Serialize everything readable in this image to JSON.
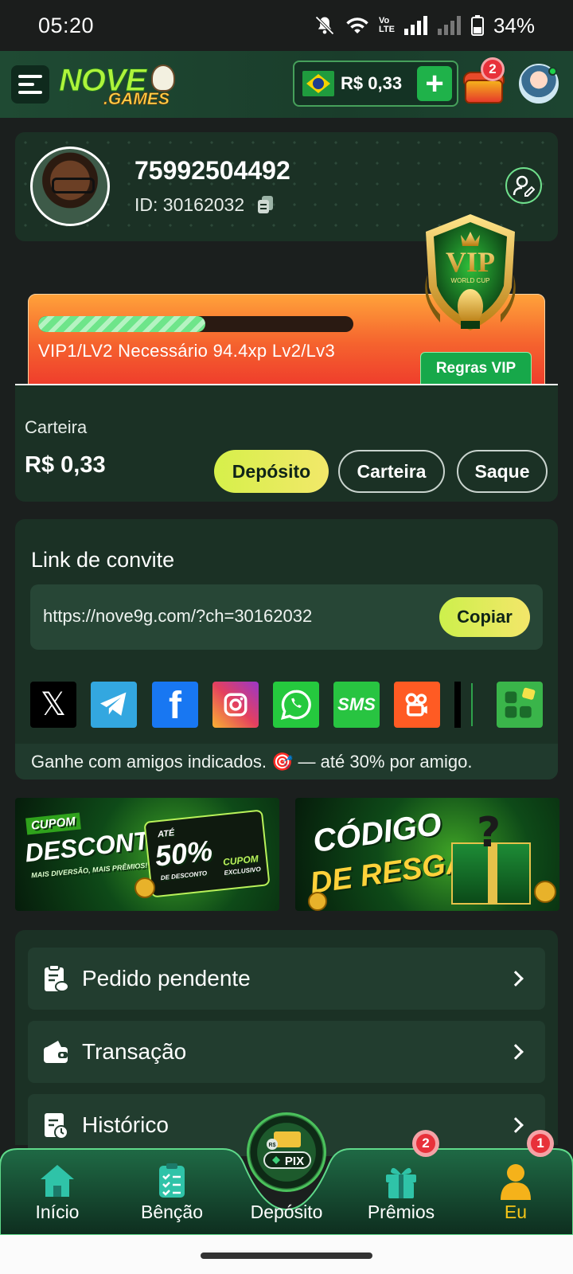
{
  "status_bar": {
    "time": "05:20",
    "battery": "34%"
  },
  "header": {
    "logo_main": "NOVE",
    "logo_sub": ".GAMES",
    "balance": "R$ 0,33",
    "chest_badge": "2"
  },
  "profile": {
    "username": "75992504492",
    "id_label": "ID: 30162032"
  },
  "vip": {
    "progress_fraction": 0.53,
    "status_text": "VIP1/LV2 Necessário 94.4xp Lv2/Lv3",
    "rules_label": "Regras VIP",
    "shield_text": "VIP",
    "shield_sub": "WORLD CUP"
  },
  "wallet": {
    "label": "Carteira",
    "amount": "R$ 0,33",
    "deposit_label": "Depósito",
    "wallet_label": "Carteira",
    "withdraw_label": "Saque"
  },
  "invite": {
    "title": "Link de convite",
    "url": "https://nove9g.com/?ch=30162032",
    "copy_label": "Copiar",
    "note": "Ganhe com amigos indicados. 🎯 — até 30% por amigo.",
    "socials": [
      "x-icon",
      "telegram-icon",
      "facebook-icon",
      "instagram-icon",
      "whatsapp-icon",
      "sms-icon",
      "kuaishou-icon",
      "tiktok-icon",
      "more-apps-icon"
    ],
    "sms_text": "SMS"
  },
  "banners": {
    "discount": {
      "tag": "CUPOM",
      "title": "DESCONTO",
      "subtitle": "MAIS DIVERSÃO, MAIS PRÊMIOS!",
      "up_to": "ATÉ",
      "percent": "50%",
      "percent_sub": "DE DESCONTO",
      "coupon": "CUPOM",
      "coupon_sub": "EXCLUSIVO"
    },
    "redeem": {
      "line1": "CÓDIGO",
      "line2": "DE RESGATE"
    }
  },
  "menu": {
    "items": [
      {
        "label": "Pedido pendente",
        "icon": "pending-order-icon"
      },
      {
        "label": "Transação",
        "icon": "wallet-icon"
      },
      {
        "label": "Histórico",
        "icon": "history-icon"
      }
    ]
  },
  "bottom_nav": {
    "items": [
      {
        "label": "Início",
        "icon": "home-icon"
      },
      {
        "label": "Bênção",
        "icon": "checklist-icon"
      },
      {
        "label": "Depósito",
        "icon": "pix-icon"
      },
      {
        "label": "Prêmios",
        "icon": "gift-icon",
        "badge": "2"
      },
      {
        "label": "Eu",
        "icon": "user-icon",
        "badge": "1"
      }
    ],
    "pix_text": "PIX",
    "active_color": "#f5c518"
  },
  "colors": {
    "accent_green": "#1fb24a",
    "card_bg": "#1b3125",
    "vip_orange": "#f5632e",
    "badge_red": "#e8313a"
  }
}
